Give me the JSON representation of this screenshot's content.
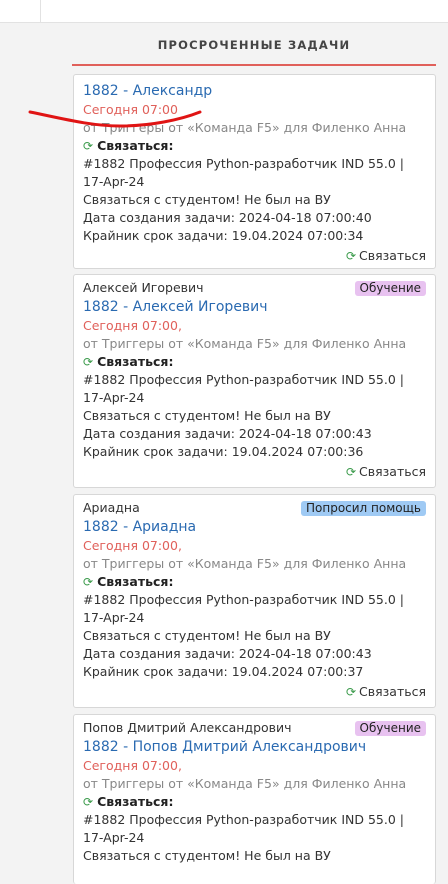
{
  "section_title": "ПРОСРОЧЕННЫЕ ЗАДАЧИ",
  "action_label": "Связаться:",
  "footer_action": "Связаться",
  "cards": [
    {
      "contact": "",
      "badge": "",
      "title": "1882 - Александр",
      "due": "Сегодня 07:00",
      "source": "от Триггеры от «Команда F5» для Филенко Анна",
      "course": "#1882 Профессия Python-разработчик IND 55.0 | 17-Apr-24",
      "message": "Связаться с студентом! Не был на ВУ",
      "created": "Дата создания задачи: 2024-04-18 07:00:40",
      "deadline": "Крайник срок задачи: 19.04.2024 07:00:34"
    },
    {
      "contact": "Алексей Игоревич",
      "badge": "Обучение",
      "title": "1882 - Алексей Игоревич",
      "due": "Сегодня 07:00,",
      "source": "от Триггеры от «Команда F5» для Филенко Анна",
      "course": "#1882 Профессия Python-разработчик IND 55.0 | 17-Apr-24",
      "message": "Связаться с студентом! Не был на ВУ",
      "created": "Дата создания задачи: 2024-04-18 07:00:43",
      "deadline": "Крайник срок задачи: 19.04.2024 07:00:36"
    },
    {
      "contact": "Ариадна",
      "badge": "Попросил помощь",
      "title": "1882 - Ариадна",
      "due": "Сегодня 07:00,",
      "source": "от Триггеры от «Команда F5» для Филенко Анна",
      "course": "#1882 Профессия Python-разработчик IND 55.0 | 17-Apr-24",
      "message": "Связаться с студентом! Не был на ВУ",
      "created": "Дата создания задачи: 2024-04-18 07:00:43",
      "deadline": "Крайник срок задачи: 19.04.2024 07:00:37"
    },
    {
      "contact": "Попов Дмитрий Александрович",
      "badge": "Обучение",
      "title": "1882 - Попов Дмитрий Александрович",
      "due": "Сегодня 07:00,",
      "source": "от Триггеры от «Команда F5» для Филенко Анна",
      "course": "#1882 Профессия Python-разработчик IND 55.0 | 17-Apr-24",
      "message": "Связаться с студентом! Не был на ВУ"
    }
  ],
  "colors": {
    "accent_red": "#e0605a",
    "link_blue": "#2a6ab1",
    "badge_learning": "#e8c2f0",
    "badge_help": "#9fcaf4",
    "refresh_green": "#3a9a4a"
  }
}
